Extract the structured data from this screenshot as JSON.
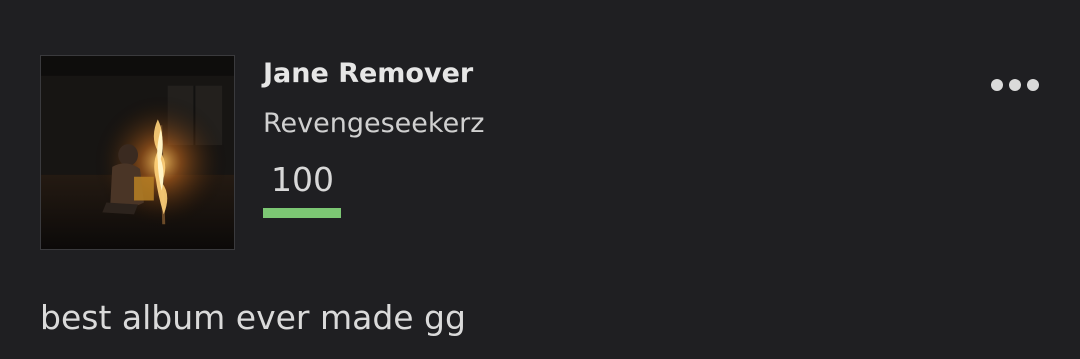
{
  "review": {
    "artist": "Jane Remover",
    "album": "Revengeseekerz",
    "score": "100",
    "score_fraction": 1.0,
    "score_color": "#7cc774",
    "comment": "best album ever made gg"
  },
  "icons": {
    "more": "more-horizontal-icon",
    "cover": "album-cover-art"
  }
}
